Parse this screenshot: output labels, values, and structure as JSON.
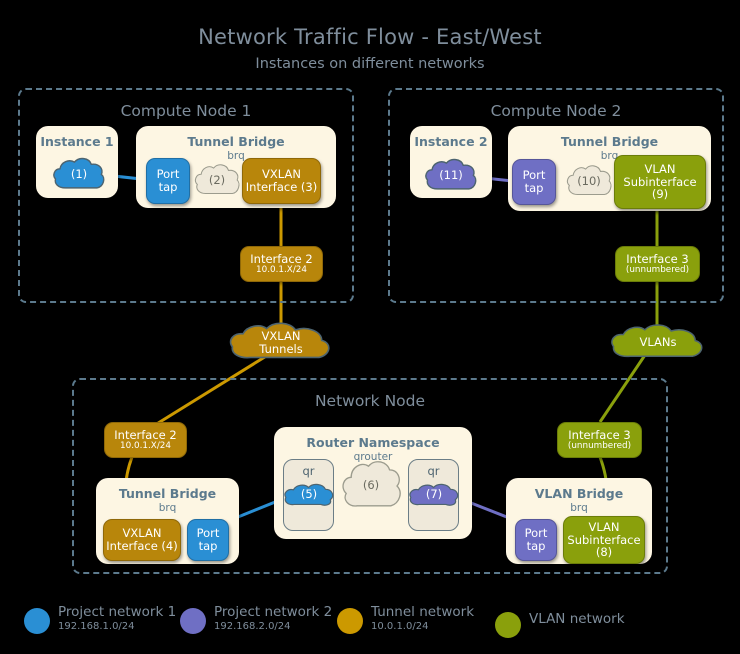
{
  "header": {
    "title": "Network Traffic Flow - East/West",
    "subtitle": "Instances on different networks"
  },
  "compute_node_1": {
    "title": "Compute Node 1",
    "instance": {
      "title": "Instance 1",
      "cloud_label": "(1)"
    },
    "bridge": {
      "title": "Tunnel Bridge",
      "subtitle": "brq"
    },
    "port_tap": {
      "l1": "Port",
      "l2": "tap"
    },
    "mid_cloud": "(2)",
    "vxlan_iface": {
      "l1": "VXLAN",
      "l2": "Interface (3)"
    },
    "interface": {
      "l1": "Interface 2",
      "sub": "10.0.1.X/24"
    }
  },
  "compute_node_2": {
    "title": "Compute Node 2",
    "instance": {
      "title": "Instance 2",
      "cloud_label": "(11)"
    },
    "bridge": {
      "title": "Tunnel Bridge",
      "subtitle": "brq"
    },
    "port_tap": {
      "l1": "Port",
      "l2": "tap"
    },
    "mid_cloud": "(10)",
    "vlan_sub": {
      "l1": "VLAN",
      "l2": "Subinterface",
      "l3": "(9)"
    },
    "interface": {
      "l1": "Interface 3",
      "sub": "(unnumbered)"
    }
  },
  "transport": {
    "vxlan_cloud": {
      "l1": "VXLAN",
      "l2": "Tunnels"
    },
    "vlan_cloud": {
      "l1": "VLANs"
    }
  },
  "network_node": {
    "title": "Network Node",
    "interface_tunnel": {
      "l1": "Interface 2",
      "sub": "10.0.1.X/24"
    },
    "interface_vlan": {
      "l1": "Interface 3",
      "sub": "(unnumbered)"
    },
    "tunnel_bridge": {
      "title": "Tunnel Bridge",
      "subtitle": "brq"
    },
    "vxlan_iface": {
      "l1": "VXLAN",
      "l2": "Interface (4)"
    },
    "tunnel_port_tap": {
      "l1": "Port",
      "l2": "tap"
    },
    "router": {
      "title": "Router Namespace",
      "subtitle": "qrouter",
      "qr_left_label": "qr",
      "qr_left_cloud": "(5)",
      "center_cloud": "(6)",
      "qr_right_label": "qr",
      "qr_right_cloud": "(7)"
    },
    "vlan_bridge": {
      "title": "VLAN Bridge",
      "subtitle": "brq"
    },
    "vlan_port_tap": {
      "l1": "Port",
      "l2": "tap"
    },
    "vlan_sub": {
      "l1": "VLAN",
      "l2": "Subinterface",
      "l3": "(8)"
    }
  },
  "legend": {
    "items": [
      {
        "name": "Project network 1",
        "subnet": "192.168.1.0/24",
        "color": "#2a8fd4"
      },
      {
        "name": "Project network 2",
        "subnet": "192.168.2.0/24",
        "color": "#6f6fc4"
      },
      {
        "name": "Tunnel network",
        "subnet": "10.0.1.0/24",
        "color": "#cc9900"
      },
      {
        "name": "VLAN network",
        "subnet": "",
        "color": "#8aa00c"
      }
    ]
  },
  "colors": {
    "project1": "#2a8fd4",
    "project2": "#6f6fc4",
    "tunnel": "#cc9900",
    "vlan": "#8aa00c",
    "panel": "#fdf6e3",
    "dashed_border": "#5c7a8d",
    "text_muted": "#7f8e9c",
    "background": "#000000"
  }
}
